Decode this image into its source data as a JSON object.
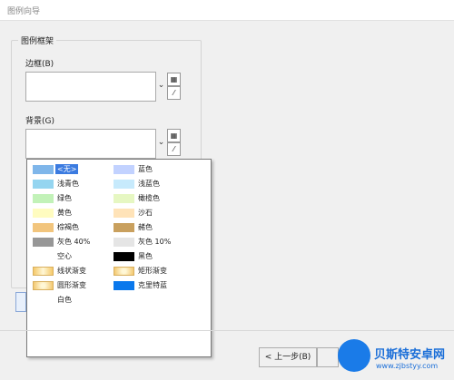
{
  "window": {
    "title": "图例向导"
  },
  "group": {
    "legend": "图例框架"
  },
  "border": {
    "label": "边框(B)"
  },
  "background": {
    "label": "背景(G)"
  },
  "picker_icons": {
    "dropdown": "chevron-down-icon",
    "table": "table-icon",
    "eyedropper": "eyedropper-icon"
  },
  "fill_menu": {
    "left": [
      {
        "label": "<无>",
        "color": "#7fb6ea",
        "selected": true
      },
      {
        "label": "浅青色",
        "color": "#95d5f0"
      },
      {
        "label": "绿色",
        "color": "#c2f2b8"
      },
      {
        "label": "黄色",
        "color": "#fffcc0"
      },
      {
        "label": "棕褐色",
        "color": "#f2c57d"
      },
      {
        "label": "灰色 40%",
        "color": "#979797"
      },
      {
        "label": "空心",
        "color": ""
      },
      {
        "label": "线状渐变",
        "color": "",
        "swatch": "gradient-linear"
      },
      {
        "label": "圆形渐变",
        "color": "",
        "swatch": "gradient-radial"
      },
      {
        "label": "白色",
        "color": ""
      }
    ],
    "right": [
      {
        "label": "蓝色",
        "color": "#c2d2ff"
      },
      {
        "label": "浅蓝色",
        "color": "#c7eafc"
      },
      {
        "label": "橄榄色",
        "color": "#e6f7c2"
      },
      {
        "label": "沙石",
        "color": "#ffe3b8"
      },
      {
        "label": "赭色",
        "color": "#c9a05e"
      },
      {
        "label": "灰色 10%",
        "color": "#e5e5e5"
      },
      {
        "label": "黑色",
        "color": "#000000"
      },
      {
        "label": "矩形渐变",
        "color": "",
        "swatch": "gradient-rect"
      },
      {
        "label": "克里特蓝",
        "color": "#0a78ec"
      }
    ]
  },
  "footer": {
    "back_label": "< 上一步(B)"
  },
  "watermark": {
    "brand": "贝斯特安卓网",
    "url": "www.zjbstyy.com"
  },
  "colors": {
    "accent": "#3b7be0",
    "watermark": "#1a6ed8"
  }
}
